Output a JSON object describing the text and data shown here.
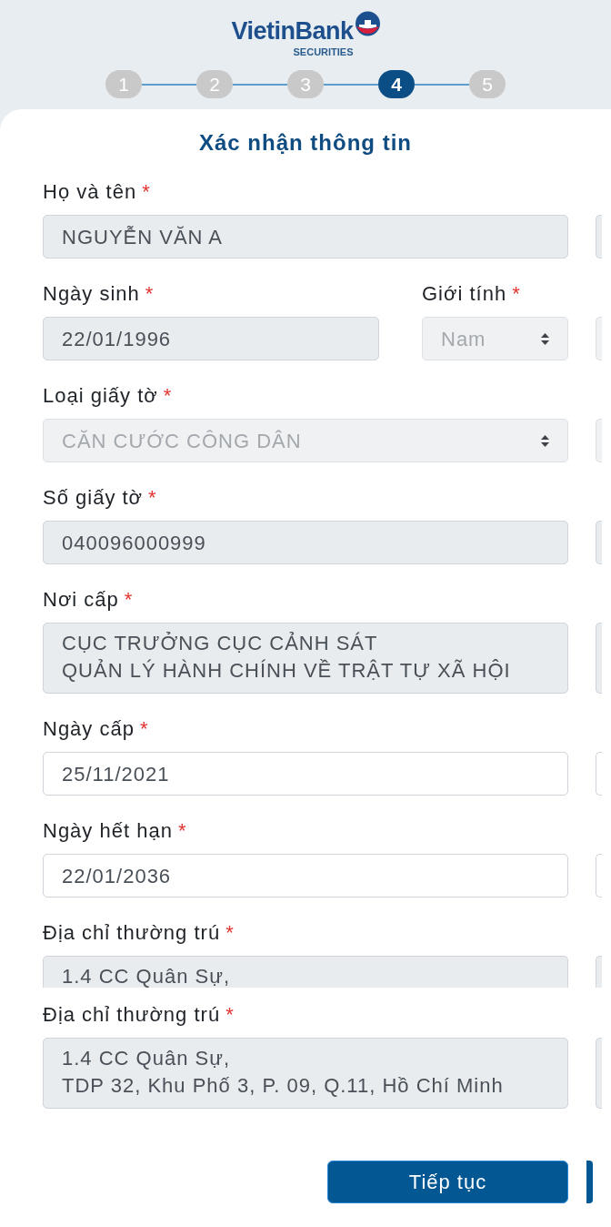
{
  "header": {
    "logo": {
      "wordmark": "VietinBank",
      "subtitle": "SECURITIES"
    },
    "steps": [
      {
        "label": "1",
        "selected": false
      },
      {
        "label": "2",
        "selected": false
      },
      {
        "label": "3",
        "selected": false
      },
      {
        "label": "4",
        "selected": true
      },
      {
        "label": "5",
        "selected": false
      }
    ]
  },
  "form": {
    "title": "Xác nhận thông tin",
    "rows": [
      {
        "fields": [
          {
            "kind": "input",
            "label": "Họ và tên",
            "required_mark": "*",
            "value": "NGUYỄN VĂN A",
            "disabled": true,
            "cut_off": false
          }
        ]
      },
      {
        "fields": [
          {
            "kind": "input",
            "label": "Ngày sinh",
            "required_mark": "*",
            "value": "22/01/1996",
            "disabled": true,
            "cut_off": false
          },
          {
            "kind": "select",
            "label": "Giới tính",
            "required_mark": "*",
            "value": "Nam",
            "disabled": true,
            "cut_off": false
          }
        ]
      },
      {
        "fields": [
          {
            "kind": "select",
            "label": "Loại giấy tờ",
            "required_mark": "*",
            "value": "CĂN CƯỚC CÔNG DÂN",
            "disabled": true,
            "cut_off": false
          }
        ]
      },
      {
        "fields": [
          {
            "kind": "input",
            "label": "Số giấy tờ",
            "required_mark": "*",
            "value": "040096000999",
            "disabled": true,
            "cut_off": false
          }
        ]
      },
      {
        "fields": [
          {
            "kind": "textarea",
            "label": "Nơi cấp",
            "required_mark": "*",
            "lines": [
              "CỤC TRƯỞNG CỤC CẢNH SÁT",
              "QUẢN LÝ HÀNH CHÍNH VỀ TRẬT TỰ XÃ HỘI"
            ],
            "disabled": true,
            "cut_off": false
          }
        ]
      },
      {
        "fields": [
          {
            "kind": "input",
            "label": "Ngày cấp",
            "required_mark": "*",
            "value": "25/11/2021",
            "disabled": false,
            "cut_off": false
          }
        ]
      },
      {
        "fields": [
          {
            "kind": "input",
            "label": "Ngày hết hạn",
            "required_mark": "*",
            "value": "22/01/2036",
            "disabled": false,
            "cut_off": false
          }
        ]
      },
      {
        "fields": [
          {
            "kind": "textarea",
            "label": "Địa chỉ thường trú",
            "required_mark": "*",
            "lines": [
              "1.4 CC Quân Sự,"
            ],
            "disabled": true,
            "cut_off": true
          }
        ]
      },
      {
        "fields": [
          {
            "kind": "textarea",
            "label": "Địa chỉ thường trú",
            "required_mark": "*",
            "lines": [
              "1.4 CC Quân Sự,",
              "TDP 32, Khu Phố 3, P. 09, Q.11, Hồ Chí Minh"
            ],
            "disabled": true,
            "cut_off": false
          }
        ]
      }
    ],
    "submit_button": "Tiếp tục"
  }
}
